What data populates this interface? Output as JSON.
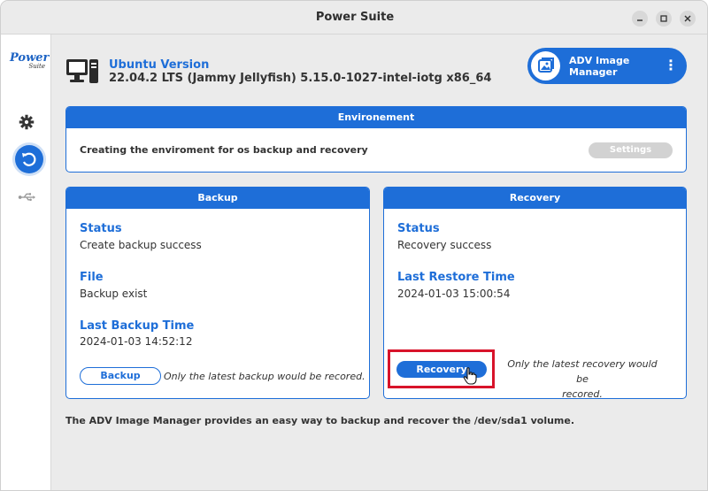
{
  "window": {
    "title": "Power Suite"
  },
  "sidebar": {
    "logo_line1": "Power",
    "logo_line2": "Suite"
  },
  "header": {
    "os_label": "Ubuntu Version",
    "os_value": "22.04.2 LTS (Jammy Jellyfish) 5.15.0-1027-intel-iotg x86_64",
    "app_button_line1": "ADV Image",
    "app_button_line2": "Manager",
    "more_glyph": "⋮"
  },
  "environment": {
    "title": "Environement",
    "description": "Creating the enviroment for os backup and recovery",
    "settings_label": "Settings"
  },
  "backup": {
    "title": "Backup",
    "status_label": "Status",
    "status_value": "Create backup success",
    "file_label": "File",
    "file_value": "Backup exist",
    "time_label": "Last Backup Time",
    "time_value": "2024-01-03 14:52:12",
    "button_label": "Backup",
    "note": "Only the latest backup would be recored."
  },
  "recovery": {
    "title": "Recovery",
    "status_label": "Status",
    "status_value": "Recovery success",
    "time_label": "Last Restore Time",
    "time_value": "2024-01-03 15:00:54",
    "button_label": "Recovery",
    "note_line1": "Only the latest recovery would be",
    "note_line2": "recored."
  },
  "footer": {
    "text": "The ADV Image Manager provides an easy way to backup and recover the /dev/sda1 volume."
  },
  "colors": {
    "accent": "#1e6ed8",
    "highlight": "#d8132a",
    "disabled": "#d2d2d2"
  }
}
